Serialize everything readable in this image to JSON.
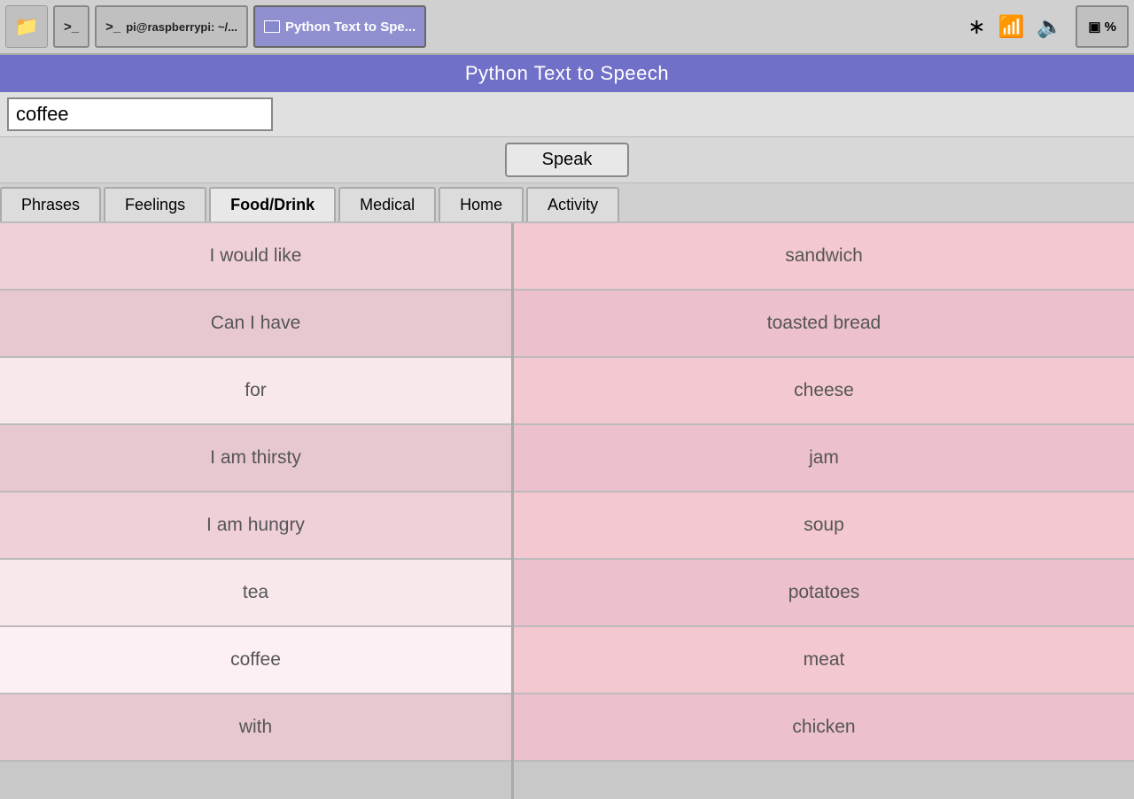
{
  "taskbar": {
    "icons": [
      {
        "name": "folder-icon",
        "symbol": "📁"
      },
      {
        "name": "terminal1-icon",
        "symbol": ">_"
      },
      {
        "name": "terminal2-icon",
        "symbol": ">_"
      }
    ],
    "terminal_label": "pi@raspberrypi: ~/...",
    "app_label": "Python Text to Spe...",
    "bluetooth_icon": "bluetooth",
    "wifi_icon": "wifi",
    "volume_icon": "volume",
    "time_label": "🔲 %"
  },
  "titlebar": {
    "title": "Python Text to Speech"
  },
  "inputbar": {
    "placeholder": "coffee",
    "value": "coffee"
  },
  "speak_button": "Speak",
  "tabs": [
    {
      "id": "phrases",
      "label": "Phrases"
    },
    {
      "id": "feelings",
      "label": "Feelings"
    },
    {
      "id": "fooddrink",
      "label": "Food/Drink"
    },
    {
      "id": "medical",
      "label": "Medical"
    },
    {
      "id": "home",
      "label": "Home"
    },
    {
      "id": "activity",
      "label": "Activity"
    }
  ],
  "active_tab": "fooddrink",
  "left_items": [
    "I would like",
    "Can I have",
    "for",
    "I am thirsty",
    "I am hungry",
    "tea",
    "coffee",
    "with"
  ],
  "right_items": [
    "sandwich",
    "toasted bread",
    "cheese",
    "jam",
    "soup",
    "potatoes",
    "meat",
    "chicken"
  ]
}
